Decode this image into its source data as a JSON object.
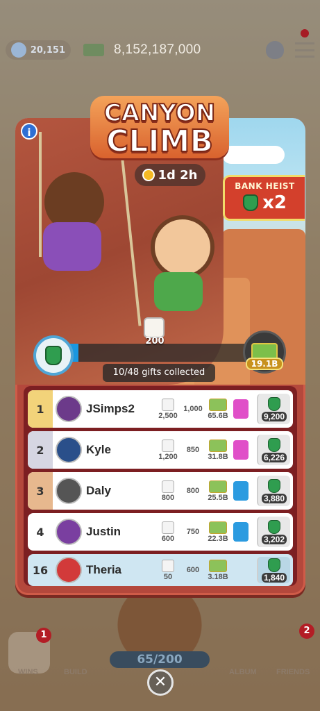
{
  "header": {
    "level": "20,151",
    "money": "8,152,187,000"
  },
  "event": {
    "title_line1": "CANYON",
    "title_line2": "CLIMB",
    "timer": "1d 2h",
    "bonus_title": "BANK HEIST",
    "bonus_multiplier": "x2"
  },
  "progress": {
    "dice_reward": "200",
    "gifts_text": "10/48 gifts collected",
    "gifts_collected": 10,
    "gifts_total": 48,
    "prize_value": "19.1B"
  },
  "leaderboard": [
    {
      "rank": "1",
      "name": "JSimps2",
      "dice": "2,500",
      "cash_small": "1,000",
      "cash": "65.6B",
      "points": "9,200",
      "card_color": "#e04fc8"
    },
    {
      "rank": "2",
      "name": "Kyle",
      "dice": "1,200",
      "cash_small": "850",
      "cash": "31.8B",
      "points": "6,226",
      "card_color": "#e04fc8"
    },
    {
      "rank": "3",
      "name": "Daly",
      "dice": "800",
      "cash_small": "800",
      "cash": "25.5B",
      "points": "3,880",
      "card_color": "#2b9be0"
    },
    {
      "rank": "4",
      "name": "Justin",
      "dice": "600",
      "cash_small": "750",
      "cash": "22.3B",
      "points": "3,202",
      "card_color": "#2b9be0"
    },
    {
      "rank": "16",
      "name": "Theria",
      "dice": "50",
      "cash_small": "600",
      "cash": "3.18B",
      "points": "1,840"
    }
  ],
  "bottom_bar": {
    "wins_label": "WINS",
    "build_label": "BUILD",
    "album_label": "ALBUM",
    "friends_label": "FRIENDS",
    "wins_badge": "1",
    "friends_badge": "2",
    "dice_counter": "65/200",
    "close": "✕"
  },
  "colors": {
    "accent_red": "#b4483c",
    "progress_blue": "#1b97e0",
    "me_row": "#cfe6f2"
  }
}
